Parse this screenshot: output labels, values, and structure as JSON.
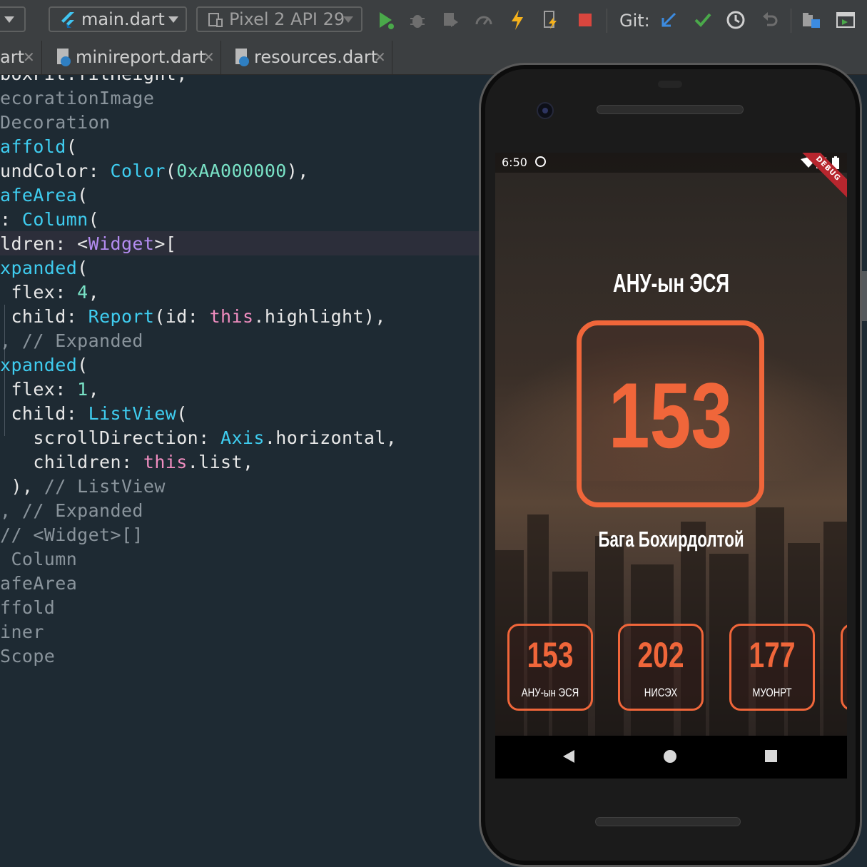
{
  "toolbar": {
    "config_selector": "main.dart",
    "device_selector": "Pixel 2 API 29",
    "git_label": "Git:",
    "icons": [
      "run-icon",
      "debug-icon",
      "profile-icon",
      "attach-icon",
      "hot-reload-icon",
      "hot-restart-icon",
      "stop-icon",
      "git-update-icon",
      "git-commit-icon",
      "history-icon",
      "rollback-icon",
      "project-structure-icon",
      "device-manager-icon"
    ]
  },
  "tabs": [
    {
      "label": "art",
      "active": false
    },
    {
      "label": "minireport.dart",
      "active": false
    },
    {
      "label": "resources.dart",
      "active": false
    }
  ],
  "editor": {
    "lines": [
      [
        {
          "t": "boxFit.fitHeight,",
          "c": "c-plain"
        }
      ],
      [
        {
          "t": "ecorationImage",
          "c": "c-ann"
        }
      ],
      [
        {
          "t": "Decoration",
          "c": "c-ann"
        }
      ],
      [
        {
          "t": "affold",
          "c": "c-cls"
        },
        {
          "t": "(",
          "c": "c-plain"
        }
      ],
      [
        {
          "t": "undColor: ",
          "c": "c-plain"
        },
        {
          "t": "Color",
          "c": "c-cls"
        },
        {
          "t": "(",
          "c": "c-plain"
        },
        {
          "t": "0xAA000000",
          "c": "c-num"
        },
        {
          "t": "),",
          "c": "c-plain"
        }
      ],
      [
        {
          "t": "afeArea",
          "c": "c-cls"
        },
        {
          "t": "(",
          "c": "c-plain"
        }
      ],
      [
        {
          "t": ": ",
          "c": "c-plain"
        },
        {
          "t": "Column",
          "c": "c-cls"
        },
        {
          "t": "(",
          "c": "c-plain"
        }
      ],
      [
        {
          "t": "ldren: <",
          "c": "c-plain"
        },
        {
          "t": "Widget",
          "c": "c-purp"
        },
        {
          "t": ">[",
          "c": "c-plain"
        }
      ],
      [
        {
          "t": "xpanded",
          "c": "c-cls"
        },
        {
          "t": "(",
          "c": "c-plain"
        }
      ],
      [
        {
          "t": " flex: ",
          "c": "c-plain"
        },
        {
          "t": "4",
          "c": "c-num"
        },
        {
          "t": ",",
          "c": "c-plain"
        }
      ],
      [
        {
          "t": " child: ",
          "c": "c-plain"
        },
        {
          "t": "Report",
          "c": "c-cls"
        },
        {
          "t": "(id: ",
          "c": "c-plain"
        },
        {
          "t": "this",
          "c": "c-kw"
        },
        {
          "t": ".highlight),",
          "c": "c-plain"
        }
      ],
      [
        {
          "t": ", // Expanded",
          "c": "c-ann"
        }
      ],
      [
        {
          "t": "xpanded",
          "c": "c-cls"
        },
        {
          "t": "(",
          "c": "c-plain"
        }
      ],
      [
        {
          "t": " flex: ",
          "c": "c-plain"
        },
        {
          "t": "1",
          "c": "c-num"
        },
        {
          "t": ",",
          "c": "c-plain"
        }
      ],
      [
        {
          "t": " child: ",
          "c": "c-plain"
        },
        {
          "t": "ListView",
          "c": "c-cls"
        },
        {
          "t": "(",
          "c": "c-plain"
        }
      ],
      [
        {
          "t": "   scrollDirection: ",
          "c": "c-plain"
        },
        {
          "t": "Axis",
          "c": "c-cls"
        },
        {
          "t": ".horizontal,",
          "c": "c-plain"
        }
      ],
      [
        {
          "t": "   children: ",
          "c": "c-plain"
        },
        {
          "t": "this",
          "c": "c-kw"
        },
        {
          "t": ".list,",
          "c": "c-plain"
        }
      ],
      [
        {
          "t": " ), ",
          "c": "c-plain"
        },
        {
          "t": "// ListView",
          "c": "c-ann"
        }
      ],
      [
        {
          "t": ", // Expanded",
          "c": "c-ann"
        }
      ],
      [
        {
          "t": "// <Widget>[]",
          "c": "c-ann"
        }
      ],
      [
        {
          "t": " Column",
          "c": "c-ann"
        }
      ],
      [
        {
          "t": "afeArea",
          "c": "c-ann"
        }
      ],
      [
        {
          "t": "ffold",
          "c": "c-ann"
        }
      ],
      [
        {
          "t": "iner",
          "c": "c-ann"
        }
      ],
      [
        {
          "t": "Scope",
          "c": "c-ann"
        }
      ]
    ]
  },
  "phone": {
    "status_time": "6:50",
    "debug_banner": "DEBUG",
    "app": {
      "title": "АНУ-ын ЭСЯ",
      "highlight_value": "153",
      "person": "Бага Бохирдолтой",
      "accent": "#f0663a",
      "reports": [
        {
          "value": "153",
          "label": "АНУ-ын ЭСЯ"
        },
        {
          "value": "202",
          "label": "НИСЭХ"
        },
        {
          "value": "177",
          "label": "МУОНРТ"
        }
      ]
    }
  }
}
